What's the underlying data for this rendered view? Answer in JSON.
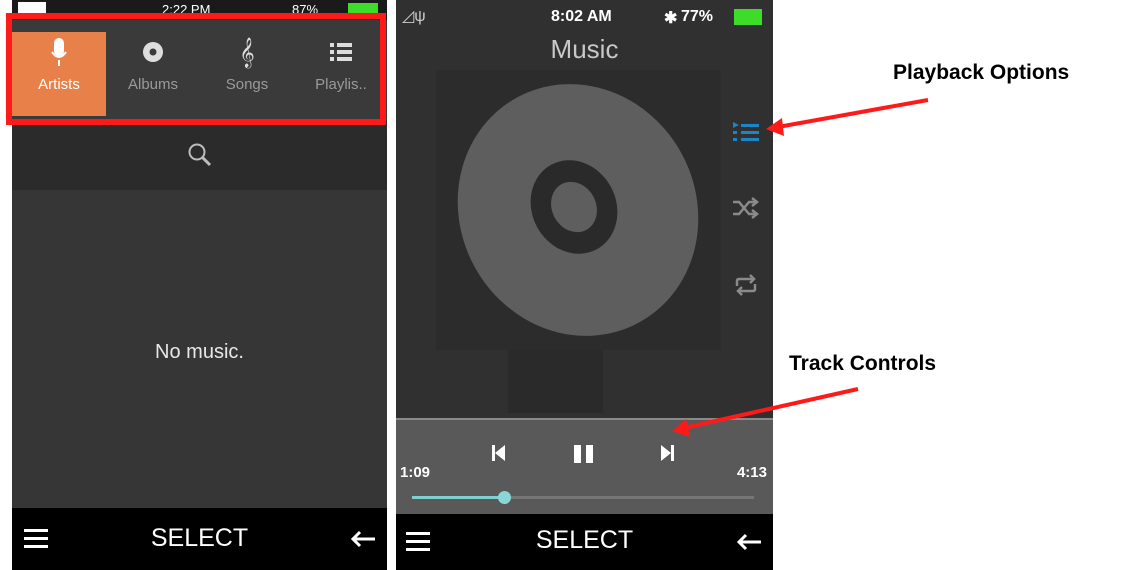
{
  "left_screen": {
    "status": {
      "time": "2:22 PM",
      "battery": "87%"
    },
    "tabs": [
      {
        "label": "Artists",
        "icon": "microphone-icon",
        "active": true
      },
      {
        "label": "Albums",
        "icon": "disc-icon",
        "active": false
      },
      {
        "label": "Songs",
        "icon": "treble-clef-icon",
        "active": false
      },
      {
        "label": "Playlis..",
        "icon": "playlist-icon",
        "active": false
      }
    ],
    "empty_message": "No music.",
    "bottom_bar": {
      "menu_icon": "menu-icon",
      "select_label": "SELECT",
      "back_icon": "back-arrow-icon"
    }
  },
  "right_screen": {
    "status": {
      "time": "8:02 AM",
      "battery": "77%"
    },
    "title": "Music",
    "side_controls": [
      "playlist-options-icon",
      "shuffle-icon",
      "repeat-icon"
    ],
    "track_controls": [
      "previous-icon",
      "pause-icon",
      "next-icon"
    ],
    "time_elapsed": "1:09",
    "time_total": "4:13",
    "progress": 0.27,
    "bottom_bar": {
      "menu_icon": "menu-icon",
      "select_label": "SELECT",
      "back_icon": "back-arrow-icon"
    }
  },
  "annotations": {
    "playback_options": "Playback Options",
    "track_controls": "Track Controls"
  },
  "colors": {
    "accent_orange": "#e8804a",
    "annotation_red": "#ff1a1a",
    "progress_teal": "#7fcfcf",
    "option_blue": "#1a86c8"
  }
}
